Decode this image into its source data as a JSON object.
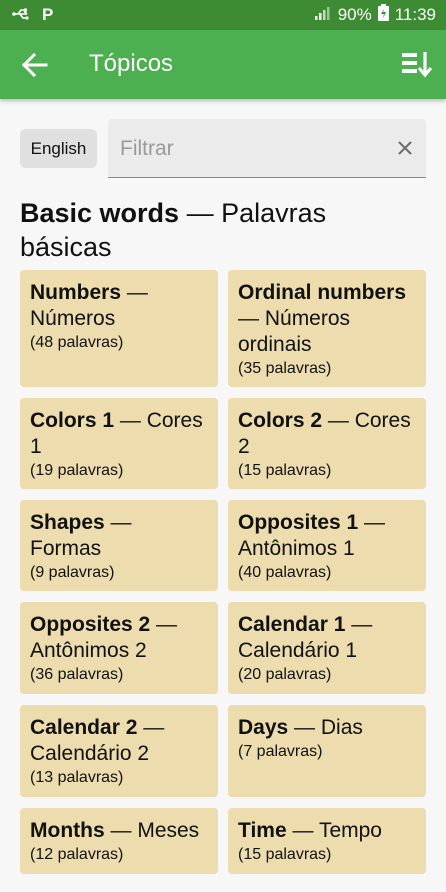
{
  "status": {
    "battery": "90%",
    "time": "11:39"
  },
  "appbar": {
    "title": "Tópicos"
  },
  "language_button": "English",
  "filter": {
    "placeholder": "Filtrar",
    "value": ""
  },
  "section": {
    "title_en": "Basic words",
    "separator": " — ",
    "title_pt": "Palavras básicas"
  },
  "topics": [
    {
      "en": "Numbers",
      "sep": " — ",
      "pt": "Números",
      "count": "(48 palavras)"
    },
    {
      "en": "Ordinal numbers",
      "sep": " — ",
      "pt": "Números ordinais",
      "count": "(35 palavras)"
    },
    {
      "en": "Colors 1",
      "sep": " — ",
      "pt": "Cores 1",
      "count": "(19 palavras)"
    },
    {
      "en": "Colors 2",
      "sep": " — ",
      "pt": "Cores 2",
      "count": "(15 palavras)"
    },
    {
      "en": "Shapes",
      "sep": " — ",
      "pt": "Formas",
      "count": "(9 palavras)"
    },
    {
      "en": "Opposites 1",
      "sep": " — ",
      "pt": "Antônimos 1",
      "count": "(40 palavras)"
    },
    {
      "en": "Opposites 2",
      "sep": " — ",
      "pt": "Antônimos 2",
      "count": "(36 palavras)"
    },
    {
      "en": "Calendar 1",
      "sep": " — ",
      "pt": "Calendário 1",
      "count": "(20 palavras)"
    },
    {
      "en": "Calendar 2",
      "sep": " — ",
      "pt": "Calendário 2",
      "count": "(13 palavras)"
    },
    {
      "en": "Days",
      "sep": " — ",
      "pt": "Dias",
      "count": "(7 palavras)"
    },
    {
      "en": "Months",
      "sep": " — ",
      "pt": "Meses",
      "count": "(12 palavras)"
    },
    {
      "en": "Time",
      "sep": " — ",
      "pt": "Tempo",
      "count": "(15 palavras)"
    }
  ],
  "colors": {
    "statusbar": "#3d8c34",
    "appbar": "#4caf50",
    "card": "#ecdcae",
    "background": "#f7f7f7"
  },
  "icons": {
    "back": "arrow-left-icon",
    "sort": "sort-icon",
    "clear": "close-icon",
    "usb": "usb-icon",
    "p": "parking-p-icon",
    "signal": "signal-icon",
    "battery": "battery-charging-icon"
  }
}
